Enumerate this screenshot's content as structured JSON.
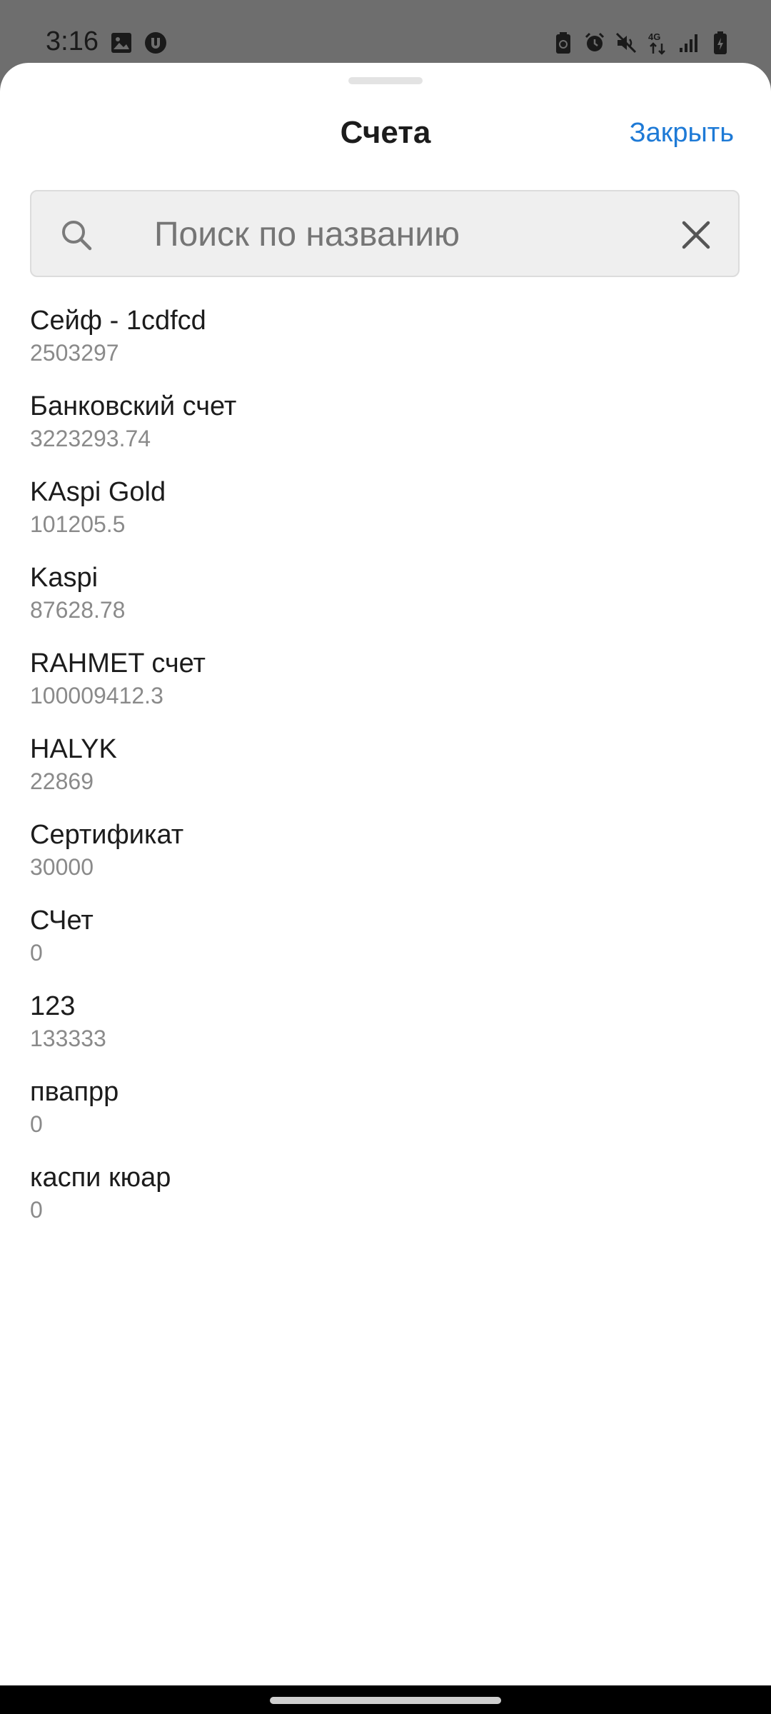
{
  "status_bar": {
    "time": "3:16",
    "left_icons": [
      "image-icon",
      "u-badge-icon"
    ],
    "right_icons": [
      "battery-saver-icon",
      "alarm-icon",
      "mute-icon",
      "network-4g-icon",
      "signal-icon",
      "battery-icon"
    ],
    "network_label": "4G"
  },
  "sheet": {
    "title": "Счета",
    "close_label": "Закрыть"
  },
  "search": {
    "placeholder": "Поиск по названию",
    "value": ""
  },
  "accounts": [
    {
      "name": "Сейф - 1cdfcd",
      "balance": "2503297"
    },
    {
      "name": "Банковский счет",
      "balance": "3223293.74"
    },
    {
      "name": "KAspi Gold",
      "balance": "101205.5"
    },
    {
      "name": "Kaspi",
      "balance": "87628.78"
    },
    {
      "name": "RAHMET счет",
      "balance": "100009412.3"
    },
    {
      "name": "HALYK",
      "balance": "22869"
    },
    {
      "name": "Сертификат",
      "balance": "30000"
    },
    {
      "name": "СЧет",
      "balance": "0"
    },
    {
      "name": "123",
      "balance": "133333"
    },
    {
      "name": "пвапрр",
      "balance": "0"
    },
    {
      "name": "каспи кюар",
      "balance": "0"
    }
  ],
  "colors": {
    "accent": "#1e7ad6",
    "status_bar_bg": "#6e6e6e",
    "secondary_text": "#8a8a8a"
  }
}
